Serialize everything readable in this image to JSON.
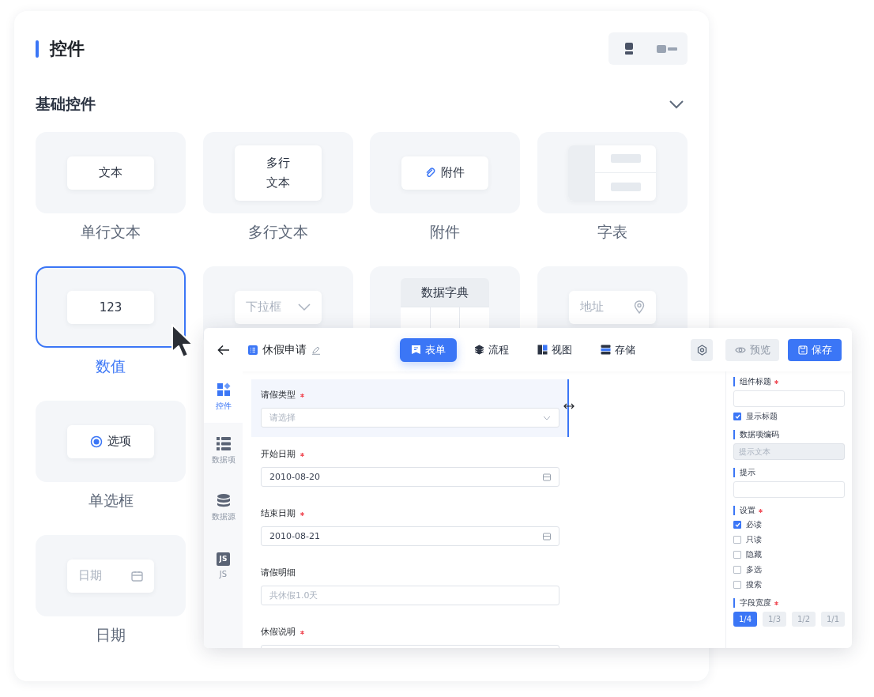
{
  "panel": {
    "title": "控件",
    "view_toggle": [
      {
        "kind": "single",
        "selected": true
      },
      {
        "kind": "double",
        "selected": false
      }
    ]
  },
  "section": {
    "title": "基础控件",
    "expanded": true
  },
  "control_rows": [
    [
      {
        "label": "单行文本",
        "kind": "text",
        "preview": [
          "文本"
        ],
        "selected": false
      },
      {
        "label": "多行文本",
        "kind": "textarea",
        "preview": [
          "多行",
          "文本"
        ],
        "selected": false
      },
      {
        "label": "附件",
        "kind": "attachment",
        "preview": [
          "附件"
        ],
        "selected": false
      },
      {
        "label": "字表",
        "kind": "subtable",
        "selected": false
      }
    ],
    [
      {
        "label": "数值",
        "kind": "number",
        "preview": [
          "123"
        ],
        "selected": true
      },
      {
        "kind": "select",
        "preview": [
          "下拉框"
        ],
        "selected": false
      },
      {
        "kind": "dictionary",
        "preview": [
          "数据字典"
        ],
        "selected": false
      },
      {
        "kind": "address",
        "preview": [
          "地址"
        ],
        "selected": false
      }
    ],
    [
      {
        "label": "单选框",
        "kind": "radio",
        "preview": [
          "选项"
        ],
        "selected": false
      }
    ],
    [
      {
        "label": "日期",
        "kind": "date",
        "preview": [
          "日期"
        ],
        "selected": false
      }
    ]
  ],
  "editor": {
    "title": "休假申请",
    "tabs": [
      {
        "label": "表单",
        "kind": "form",
        "selected": true
      },
      {
        "label": "流程",
        "kind": "flow",
        "selected": false
      },
      {
        "label": "视图",
        "kind": "view",
        "selected": false
      },
      {
        "label": "存储",
        "kind": "storage",
        "selected": false
      }
    ],
    "preview_button": {
      "label": "预览",
      "disabled": true
    },
    "save_button": {
      "label": "保存"
    },
    "sidebar": [
      {
        "label": "控件",
        "kind": "widgets",
        "selected": true
      },
      {
        "label": "数据项",
        "kind": "list",
        "selected": false
      },
      {
        "label": "数据源",
        "kind": "database",
        "selected": false
      },
      {
        "label": "JS",
        "kind": "js",
        "badge": "JS",
        "selected": false
      }
    ],
    "fields": [
      {
        "label": "请假类型",
        "required": true,
        "kind": "select",
        "placeholder": "请选择",
        "selected": true
      },
      {
        "label": "开始日期",
        "required": true,
        "kind": "date",
        "value": "2010-08-20",
        "selected": false
      },
      {
        "label": "结束日期",
        "required": true,
        "kind": "date",
        "value": "2010-08-21",
        "selected": false
      },
      {
        "label": "请假明细",
        "required": false,
        "kind": "text",
        "placeholder": "共休假1.0天",
        "selected": false
      },
      {
        "label": "休假说明",
        "required": true,
        "kind": "text",
        "selected": false
      }
    ],
    "properties": [
      {
        "title": "组件标题",
        "required": true,
        "input": {
          "disabled": false
        },
        "checks": [
          {
            "label": "显示标题",
            "checked": true
          }
        ]
      },
      {
        "title": "数据项编码",
        "required": false,
        "input": {
          "placeholder": "提示文本",
          "disabled": true
        }
      },
      {
        "title": "提示",
        "required": false,
        "input": {
          "disabled": false
        }
      },
      {
        "title": "设置",
        "required": true,
        "checks": [
          {
            "label": "必读",
            "checked": true
          },
          {
            "label": "只读",
            "checked": false
          },
          {
            "label": "隐藏",
            "checked": false
          },
          {
            "label": "多选",
            "checked": false
          },
          {
            "label": "搜索",
            "checked": false
          }
        ]
      },
      {
        "title": "字段宽度",
        "required": true,
        "widths": [
          {
            "label": "1/4",
            "selected": true
          },
          {
            "label": "1/3",
            "selected": false
          },
          {
            "label": "1/2",
            "selected": false
          },
          {
            "label": "1/1",
            "selected": false
          }
        ]
      }
    ]
  }
}
